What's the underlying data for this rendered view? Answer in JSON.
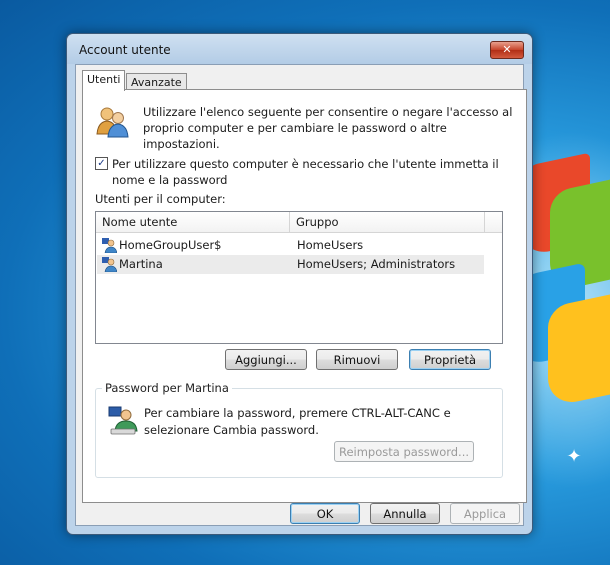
{
  "window": {
    "title": "Account utente",
    "close_label": "✕"
  },
  "tabs": [
    {
      "label": "Utenti"
    },
    {
      "label": "Avanzate"
    }
  ],
  "intro": {
    "text": "Utilizzare l'elenco seguente per consentire o negare l'accesso al proprio computer e per cambiare le password o altre impostazioni.",
    "icon": "users-icon"
  },
  "require_login": {
    "checked": true,
    "check_glyph": "✓",
    "label": "Per utilizzare questo computer è necessario che l'utente immetta il nome e la password"
  },
  "users_list": {
    "label": "Utenti per il computer:",
    "columns": [
      "Nome utente",
      "Gruppo"
    ],
    "rows": [
      {
        "name": "HomeGroupUser$",
        "group": "HomeUsers",
        "icon": "user-icon"
      },
      {
        "name": "Martina",
        "group": "HomeUsers; Administrators",
        "icon": "user-icon"
      }
    ]
  },
  "list_buttons": {
    "add": "Aggiungi...",
    "remove": "Rimuovi",
    "properties": "Proprietà"
  },
  "password_group": {
    "title": "Password per Martina",
    "text": "Per cambiare la password, premere CTRL-ALT-CANC e selezionare Cambia password.",
    "reset_button": "Reimposta password...",
    "icon": "user-keyboard-icon"
  },
  "dialog_buttons": {
    "ok": "OK",
    "cancel": "Annulla",
    "apply": "Applica"
  },
  "desktop": {
    "sparkle_glyph": "✦"
  },
  "colors": {
    "desktop_blue": "#1d8ad0",
    "window_frame": "#bcd3ea",
    "close_red": "#c7432a"
  }
}
